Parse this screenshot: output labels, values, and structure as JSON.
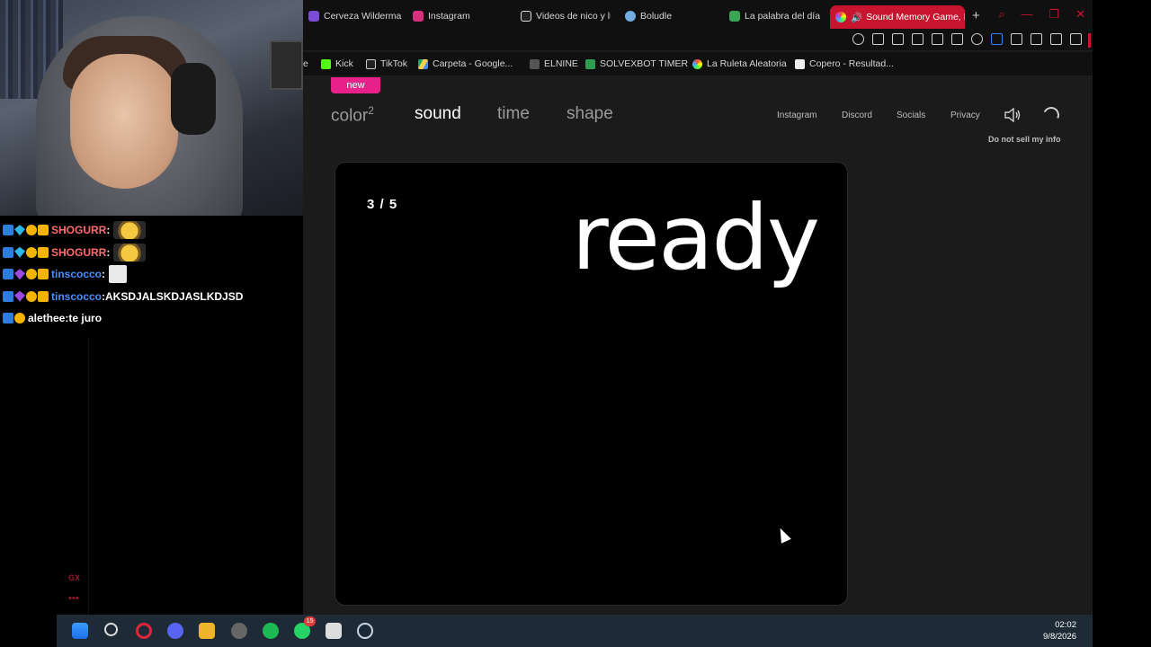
{
  "chat": {
    "messages": [
      {
        "user": "SHOGURR",
        "text": "",
        "emote": "pepe-laugh-emote"
      },
      {
        "user": "SHOGURR",
        "text": "",
        "emote": "pepe-laugh-emote"
      },
      {
        "user": "tinscocco",
        "text": "",
        "emote": "sticker-emote"
      },
      {
        "user": "tinscocco",
        "text": "AKSDJALSKDJASLKDJSD",
        "emote": ""
      },
      {
        "user": "alethee",
        "text": "te juro",
        "emote": ""
      }
    ],
    "separator": " : "
  },
  "browser": {
    "tabs": [
      {
        "label": "Cerveza Wilderma"
      },
      {
        "label": "Instagram"
      },
      {
        "label": "Videos de nico y lu"
      },
      {
        "label": "Boludle"
      },
      {
        "label": "La palabra del día"
      },
      {
        "label": "Sound Memory Game, I"
      }
    ],
    "new_tab": "+",
    "bookmarks": [
      {
        "label": "e"
      },
      {
        "label": "Kick"
      },
      {
        "label": "TikTok"
      },
      {
        "label": "Carpeta - Google..."
      },
      {
        "label": "ELNINE"
      },
      {
        "label": "SOLVEXBOT TIMER"
      },
      {
        "label": "La Ruleta Aleatoria"
      },
      {
        "label": "Copero - Resultad..."
      }
    ]
  },
  "page": {
    "new_badge": "new",
    "nav": {
      "color": "color",
      "color_sup": "2",
      "sound": "sound",
      "time": "time",
      "shape": "shape"
    },
    "links": {
      "instagram": "Instagram",
      "discord": "Discord",
      "socials": "Socials",
      "privacy": "Privacy",
      "do_not_sell": "Do not sell my info"
    },
    "game": {
      "counter": "3 / 5",
      "status": "ready"
    }
  },
  "taskbar": {
    "time": "02:02",
    "date": "9/8/2026",
    "notification_count": "15"
  },
  "overlay": {
    "gx": "GX",
    "dots": "•••"
  },
  "colors": {
    "accent": "#c9142f",
    "new_pill": "#e8208a",
    "active_tab": "#c9142f"
  }
}
